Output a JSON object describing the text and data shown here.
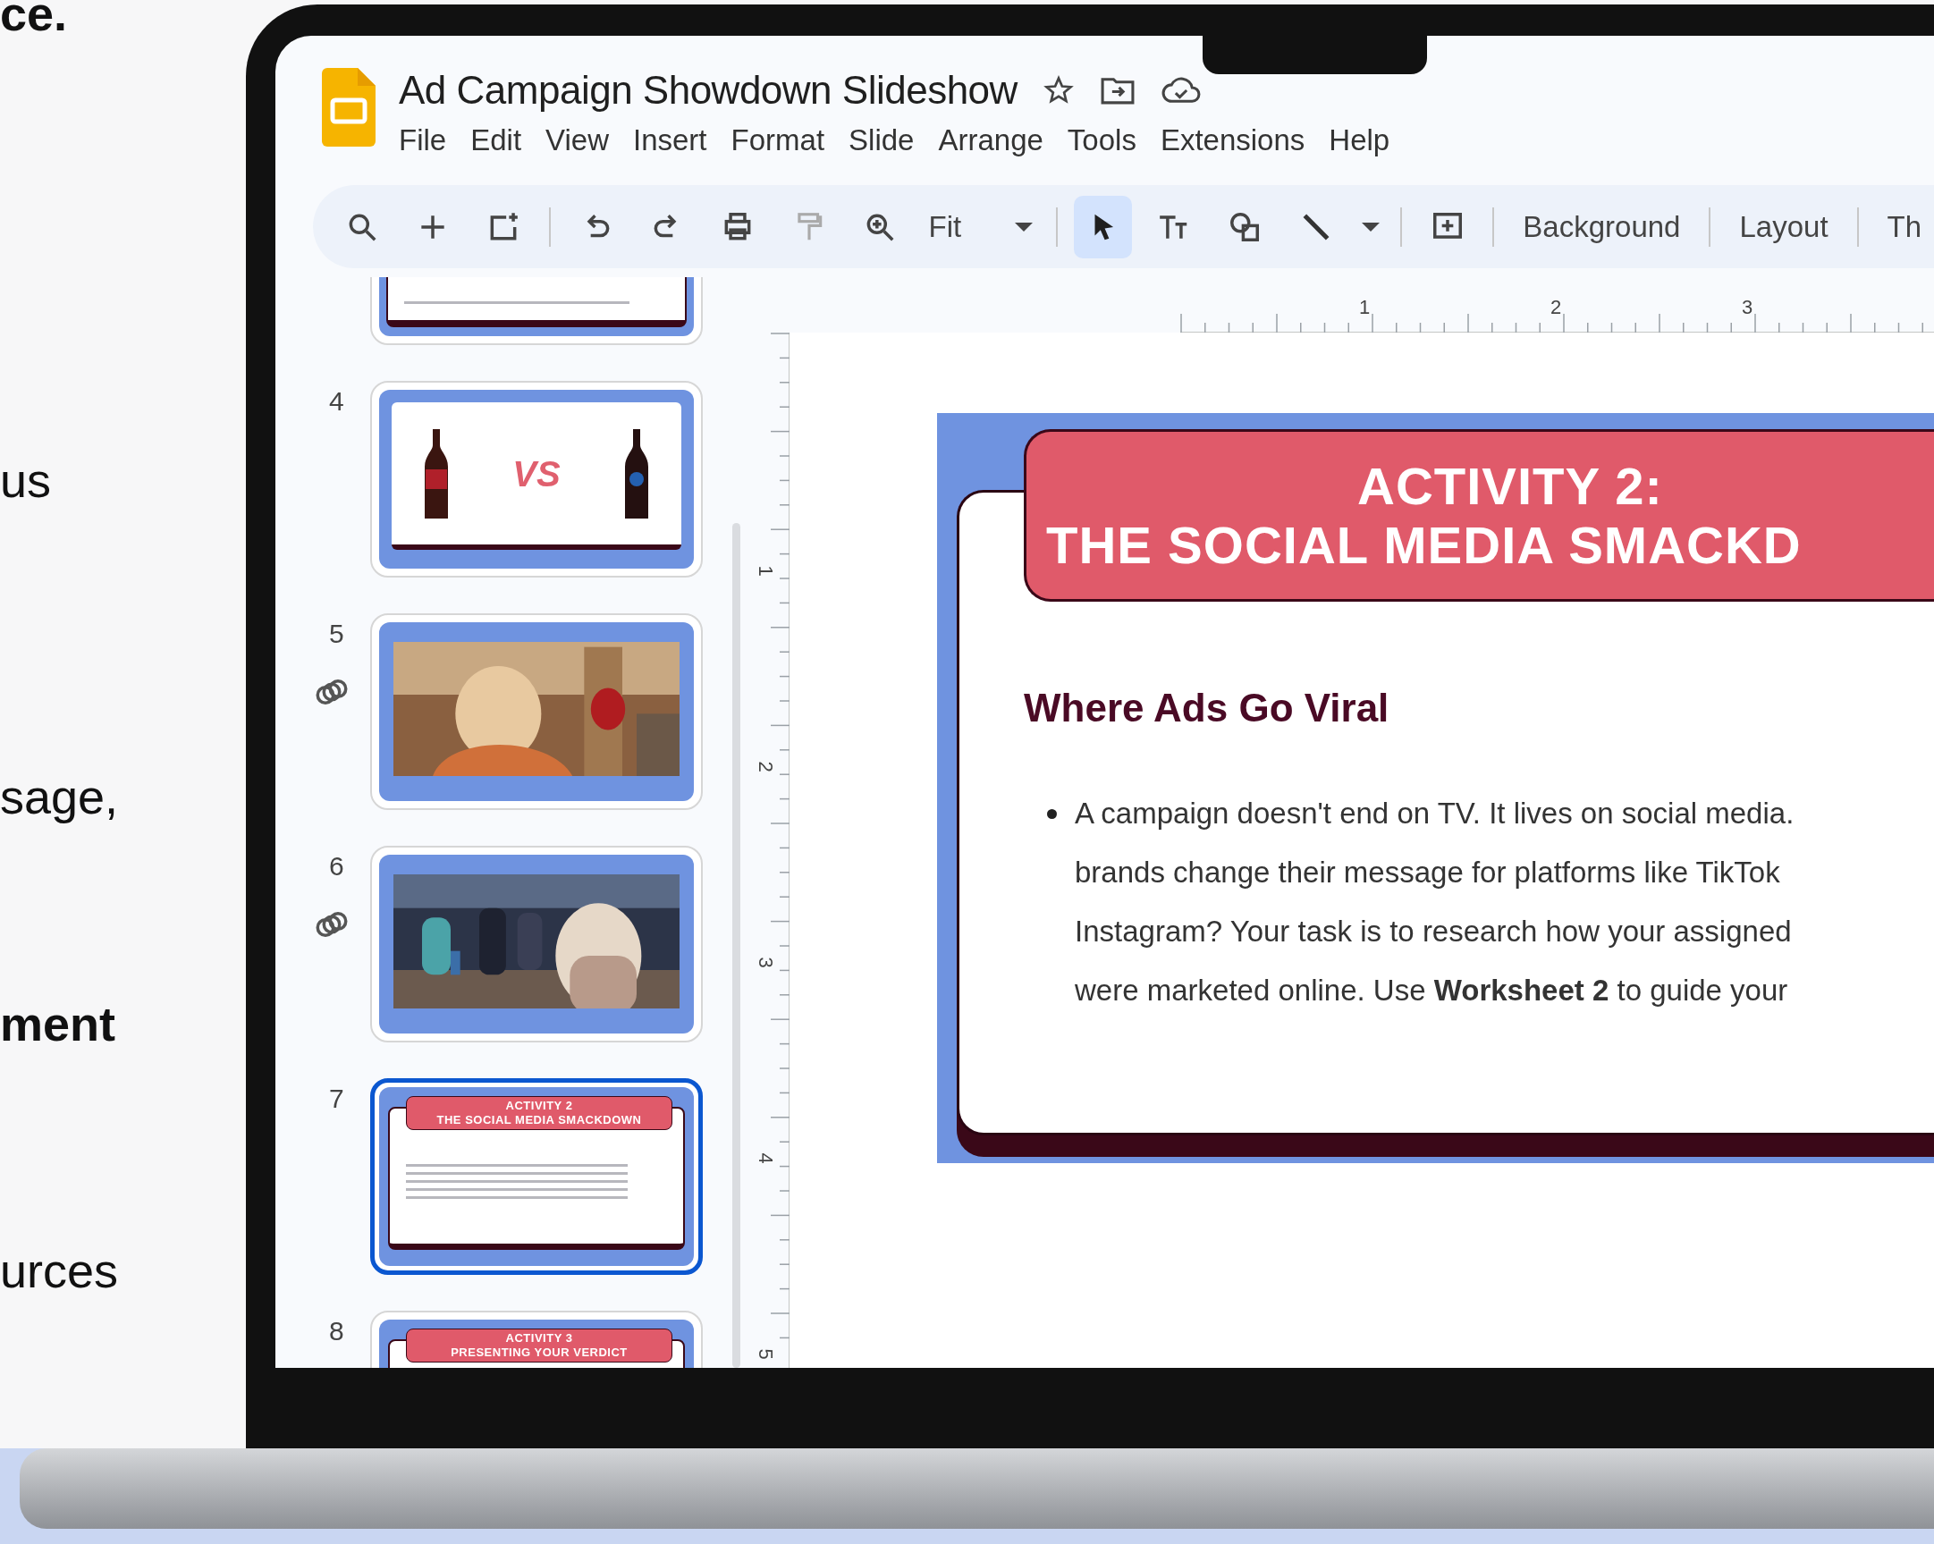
{
  "promo_text": [
    {
      "text": "ce.",
      "bold": true
    },
    {
      "text": "us",
      "bold": false
    },
    {
      "text": "sage,",
      "bold": false
    },
    {
      "text": "ment",
      "bold": true
    },
    {
      "text": "urces",
      "bold": false
    }
  ],
  "app": {
    "title": "Ad Campaign Showdown Slideshow",
    "menu": [
      "File",
      "Edit",
      "View",
      "Insert",
      "Format",
      "Slide",
      "Arrange",
      "Tools",
      "Extensions",
      "Help"
    ],
    "tools": [
      {
        "kind": "search",
        "selected": false
      },
      {
        "kind": "plus",
        "selected": false
      },
      {
        "kind": "new-slide",
        "selected": false
      },
      {
        "kind": "sep"
      },
      {
        "kind": "undo",
        "selected": false
      },
      {
        "kind": "redo",
        "selected": false
      },
      {
        "kind": "print",
        "selected": false
      },
      {
        "kind": "paint",
        "selected": false
      },
      {
        "kind": "zoom",
        "selected": false
      },
      {
        "kind": "zoom-field",
        "label": "Fit"
      },
      {
        "kind": "sep"
      },
      {
        "kind": "select",
        "selected": true
      },
      {
        "kind": "text",
        "selected": false
      },
      {
        "kind": "shapes",
        "selected": false
      },
      {
        "kind": "line",
        "selected": false
      },
      {
        "kind": "caret",
        "selected": false
      },
      {
        "kind": "sep"
      },
      {
        "kind": "comment",
        "selected": false
      },
      {
        "kind": "sep"
      },
      {
        "kind": "button",
        "label": "Background"
      },
      {
        "kind": "sep"
      },
      {
        "kind": "button",
        "label": "Layout"
      },
      {
        "kind": "sep"
      },
      {
        "kind": "button",
        "label": "Th"
      }
    ],
    "ruler_numbers": [
      "1",
      "2",
      "3"
    ],
    "vertical_ruler_numbers": [
      "1",
      "2",
      "3",
      "4",
      "5"
    ]
  },
  "slides": [
    {
      "kind": "text",
      "selected": false
    },
    {
      "number": "4",
      "kind": "bottles",
      "label": "VS",
      "selected": false,
      "linked": false
    },
    {
      "number": "5",
      "selected": false,
      "linked": true
    },
    {
      "number": "6",
      "kind": "photo-dark",
      "selected": false,
      "linked": true
    },
    {
      "number": "7",
      "kind": "title",
      "title_lines": [
        "ACTIVITY 2",
        "THE SOCIAL MEDIA SMACKDOWN"
      ],
      "selected": true,
      "linked": false
    },
    {
      "number": "8",
      "kind": "title",
      "title_lines": [
        "ACTIVITY 3",
        "PRESENTING YOUR VERDICT"
      ],
      "selected": false
    }
  ],
  "current_slide": {
    "title_lines": [
      "ACTIVITY 2:",
      "THE SOCIAL MEDIA SMACKD"
    ],
    "heading": "Where Ads Go Viral",
    "bullet_lines": [
      "A campaign doesn't end on TV. It lives on social media.",
      "brands change their message for platforms like TikTok",
      "Instagram? Your task is to research how your assigned",
      "were marketed online. Use **Worksheet 2** to guide your"
    ]
  }
}
